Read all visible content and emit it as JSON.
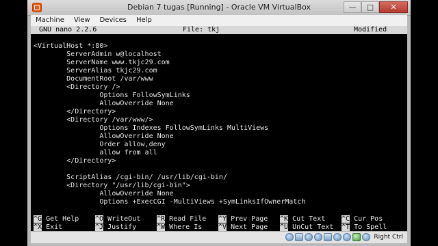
{
  "window": {
    "title": "Debian 7 tugas [Running] - Oracle VM VirtualBox"
  },
  "menu": [
    "Machine",
    "View",
    "Devices",
    "Help"
  ],
  "nano": {
    "version": "GNU nano 2.2.6",
    "file": "File: tkj",
    "status": "Modified"
  },
  "editor_lines": [
    "<VirtualHost *:80>",
    "        ServerAdmin w@localhost",
    "        ServerName www.tkjc29.com",
    "        ServerAlias tkjc29.com",
    "        DocumentRoot /var/www",
    "        <Directory />",
    "                Options FollowSymLinks",
    "                AllowOverride None",
    "        </Directory>",
    "        <Directory /var/www/>",
    "                Options Indexes FollowSymLinks MultiViews",
    "                AllowOverride None",
    "                Order allow,deny",
    "                allow from all",
    "        </Directory>",
    "",
    "        ScriptAlias /cgi-bin/ /usr/lib/cgi-bin/",
    "        <Directory \"/usr/lib/cgi-bin\">",
    "                AllowOverride None",
    "                Options +ExecCGI -MultiViews +SymLinksIfOwnerMatch"
  ],
  "shortcuts_row1": [
    {
      "key": "^G",
      "label": "Get Help"
    },
    {
      "key": "^O",
      "label": "WriteOut"
    },
    {
      "key": "^R",
      "label": "Read File"
    },
    {
      "key": "^Y",
      "label": "Prev Page"
    },
    {
      "key": "^K",
      "label": "Cut Text"
    },
    {
      "key": "^C",
      "label": "Cur Pos"
    }
  ],
  "shortcuts_row2": [
    {
      "key": "^X",
      "label": "Exit"
    },
    {
      "key": "^J",
      "label": "Justify"
    },
    {
      "key": "^W",
      "label": "Where Is"
    },
    {
      "key": "^V",
      "label": "Next Page"
    },
    {
      "key": "^U",
      "label": "UnCut Text"
    },
    {
      "key": "^T",
      "label": "To Spell"
    }
  ],
  "statusbar": {
    "host_key": "Right Ctrl",
    "icons": [
      "hdd-icon",
      "optical-icon",
      "usb-icon",
      "shared-folder-icon",
      "network-icon",
      "display-icon",
      "recording-icon",
      "mouse-integration-icon",
      "cpu-icon"
    ]
  }
}
